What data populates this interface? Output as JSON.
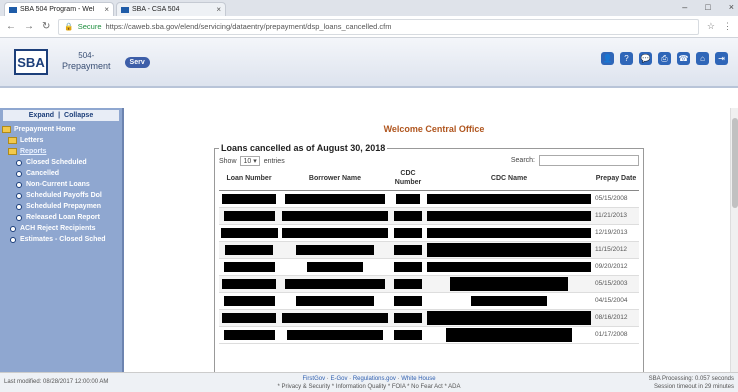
{
  "browser": {
    "tabs": [
      {
        "title": "SBA 504 Program - Wel",
        "active": true
      },
      {
        "title": "SBA - CSA 504",
        "active": false
      }
    ],
    "secure_label": "Secure",
    "url": "https://caweb.sba.gov/elend/servicing/dataentry/prepayment/dsp_loans_cancelled.cfm"
  },
  "header": {
    "logo": "SBA",
    "app_line1": "504-",
    "app_line2": "Prepayment",
    "serv_label": "Serv",
    "icons": [
      "user-icon",
      "help-icon",
      "chat-icon",
      "print-icon",
      "phone-icon",
      "home-icon",
      "logout-icon"
    ]
  },
  "sidebar": {
    "expand": "Expand",
    "separator": "|",
    "collapse": "Collapse",
    "items": [
      {
        "label": "Prepayment Home",
        "kind": "folder",
        "level": 0
      },
      {
        "label": "Letters",
        "kind": "folder",
        "level": 1
      },
      {
        "label": "Reports",
        "kind": "folder-link",
        "level": 1
      },
      {
        "label": "Closed Scheduled",
        "kind": "bullet",
        "level": 2
      },
      {
        "label": "Cancelled",
        "kind": "bullet",
        "level": 2
      },
      {
        "label": "Non-Current Loans",
        "kind": "bullet",
        "level": 2
      },
      {
        "label": "Scheduled Payoffs Dol",
        "kind": "bullet",
        "level": 2
      },
      {
        "label": "Scheduled Prepaymen",
        "kind": "bullet",
        "level": 2
      },
      {
        "label": "Released Loan Report",
        "kind": "bullet",
        "level": 2
      },
      {
        "label": "ACH Reject Recipients",
        "kind": "bullet",
        "level": 1
      },
      {
        "label": "Estimates - Closed Sched",
        "kind": "bullet",
        "level": 1
      }
    ]
  },
  "main": {
    "welcome": "Welcome Central Office",
    "legend": "Loans cancelled as of August 30, 2018",
    "show_label": "Show",
    "show_value": "10",
    "entries_label": "entries",
    "search_label": "Search:",
    "columns": [
      "Loan Number",
      "Borrower Name",
      "CDC Number",
      "CDC Name",
      "Prepay Date"
    ],
    "rows": [
      {
        "date": "05/15/2008"
      },
      {
        "date": "11/21/2013"
      },
      {
        "date": "12/19/2013"
      },
      {
        "date": "11/15/2012"
      },
      {
        "date": "09/20/2012"
      },
      {
        "date": "05/15/2003"
      },
      {
        "date": "04/15/2004"
      },
      {
        "date": "08/16/2012"
      },
      {
        "date": "01/17/2008"
      }
    ]
  },
  "footer": {
    "last_modified": "Last modified: 08/28/2017 12:00:00 AM",
    "links": [
      "FirstGov",
      "E-Gov",
      "Regulations.gov",
      "White House"
    ],
    "policies": "* Privacy & Security  * Information Quality  * FOIA  * No Fear Act  * ADA",
    "processing": "SBA Processing: 0.057 seconds",
    "timeout": "Session timeout in 29 minutes"
  }
}
